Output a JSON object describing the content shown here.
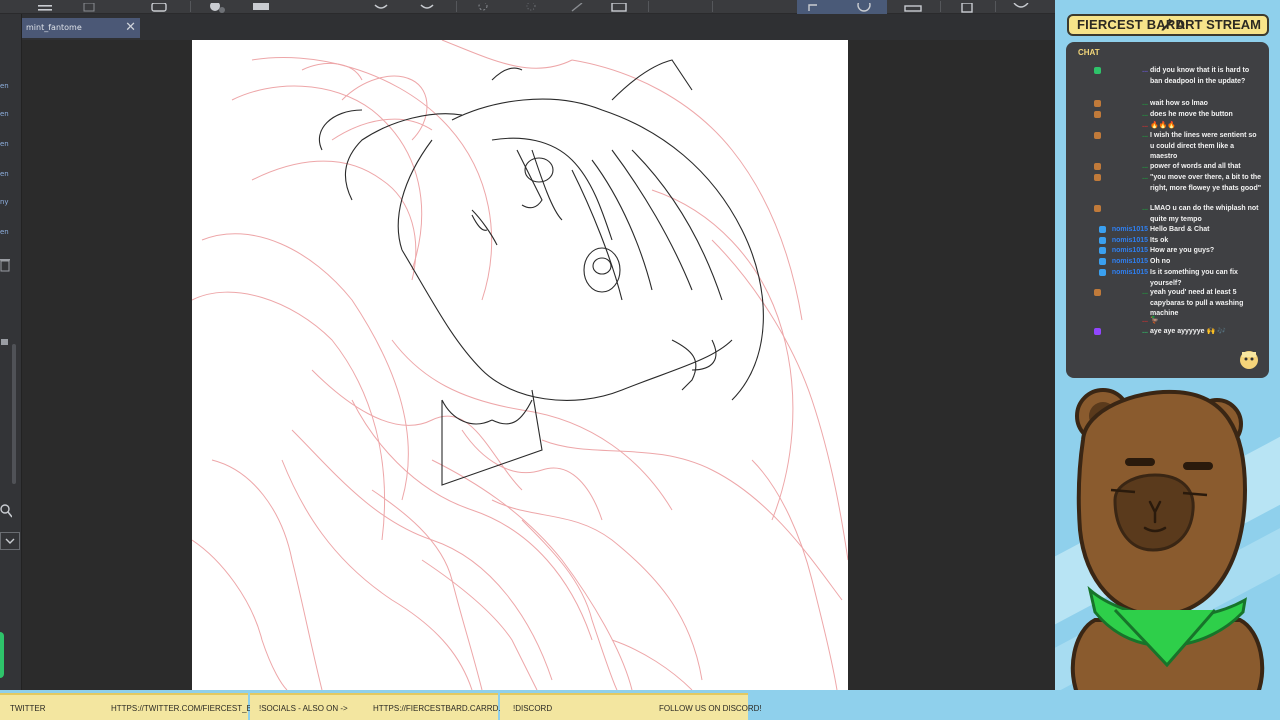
{
  "toolbar": {
    "icons": [
      "menu-icon",
      "new-file-icon",
      "save-icon",
      "undo-icon",
      "redo-icon",
      "loading-icon",
      "transform-icon",
      "crop-icon",
      "select-icon",
      "lasso-icon",
      "ruler-icon",
      "device-icon",
      "comment-icon"
    ]
  },
  "document": {
    "tab_name": "mint_fantome",
    "close_glyph": "✕"
  },
  "left_panel": {
    "item_labels": [
      "en",
      "en",
      "en",
      "en",
      "ny",
      "en"
    ]
  },
  "overlay": {
    "streamer_name": "FIERCEST BARD",
    "stream_title": "ART STREAM",
    "chat_label": "CHAT",
    "colors": {
      "header_bg": "#f7e48a",
      "chat_bg": "#3f4043",
      "overlay_bg": "#8fd0ec"
    }
  },
  "chat": [
    {
      "user": "...",
      "user_color": "#6b58d8",
      "badge_color": "#2ec36a",
      "text": "did you know that it is hard to ban deadpool in the update?"
    },
    {
      "user": "...",
      "user_color": "#1f9d3f",
      "badge_color": "#c07a3a",
      "text": "wait how so lmao"
    },
    {
      "user": "...",
      "user_color": "#1f9d3f",
      "badge_color": "#c07a3a",
      "text": "does he move the button"
    },
    {
      "user": "...",
      "user_color": "#d23131",
      "badge_color": "",
      "text": "🔥🔥🔥"
    },
    {
      "user": "...",
      "user_color": "#1f9d3f",
      "badge_color": "#c07a3a",
      "text": "I wish the lines were sentient so u could direct them like a maestro"
    },
    {
      "user": "...",
      "user_color": "#1f9d3f",
      "badge_color": "#c07a3a",
      "text": "power of words and all that"
    },
    {
      "user": "...",
      "user_color": "#1f9d3f",
      "badge_color": "#c07a3a",
      "text": "\"you move over there, a bit to the right, more flowey ye thats good\""
    },
    {
      "user": "...",
      "user_color": "#1f9d3f",
      "badge_color": "#c07a3a",
      "text": "LMAO u can do the whiplash not quite my tempo"
    },
    {
      "user": "nomis1015",
      "user_color": "#2f7ff0",
      "badge_color": "#3aa0f0",
      "text": "Hello Bard & Chat"
    },
    {
      "user": "nomis1015",
      "user_color": "#2f7ff0",
      "badge_color": "#3aa0f0",
      "text": "Its ok"
    },
    {
      "user": "nomis1015",
      "user_color": "#2f7ff0",
      "badge_color": "#3aa0f0",
      "text": "How are you guys?"
    },
    {
      "user": "nomis1015",
      "user_color": "#2f7ff0",
      "badge_color": "#3aa0f0",
      "text": "Oh no"
    },
    {
      "user": "nomis1015",
      "user_color": "#2f7ff0",
      "badge_color": "#3aa0f0",
      "text": "Is it something you can fix yourself?"
    },
    {
      "user": "...",
      "user_color": "#1f9d3f",
      "badge_color": "#c07a3a",
      "text": "yeah youd' need at least 5 capybaras to pull a washing machine"
    },
    {
      "user": "...",
      "user_color": "#d23131",
      "badge_color": "",
      "text": "🦆"
    },
    {
      "user": "...",
      "user_color": "#2ec36a",
      "badge_color": "#9146ff",
      "text": "aye aye ayyyyye 🙌 🎶"
    }
  ],
  "ticker": [
    {
      "label": "TWITTER",
      "value": "HTTPS://TWITTER.COM/FIERCEST_BARD"
    },
    {
      "label": "!SOCIALS - ALSO ON ->",
      "value": "HTTPS://FIERCESTBARD.CARRD.CO/"
    },
    {
      "label": "!DISCORD",
      "value": "FOLLOW US ON DISCORD!"
    }
  ]
}
